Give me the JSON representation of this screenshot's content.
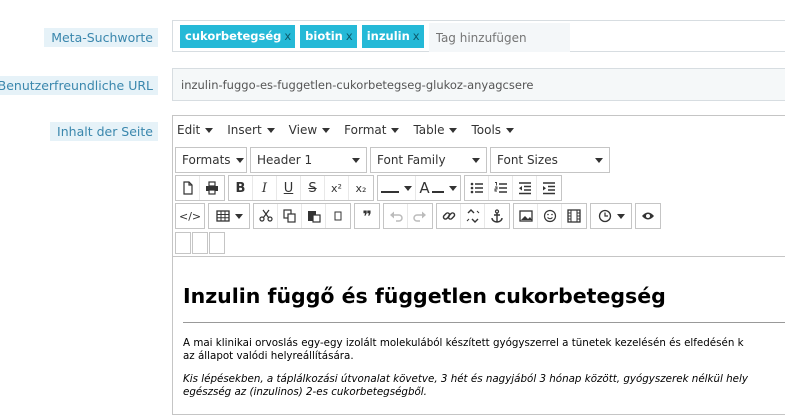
{
  "labels": {
    "meta": "Meta-Suchworte",
    "url": "Benutzerfreundliche URL",
    "content": "Inhalt der Seite"
  },
  "tags": [
    "cukorbetegség",
    "biotin",
    "inzulin"
  ],
  "tag_remove": "x",
  "tag_placeholder": "Tag hinzufügen",
  "url_value": "inzulin-fuggo-es-fuggetlen-cukorbetegseg-glukoz-anyagcsere",
  "editor": {
    "menu": [
      "Edit",
      "Insert",
      "View",
      "Format",
      "Table",
      "Tools"
    ],
    "selects": {
      "formats": "Formats",
      "block": "Header 1",
      "font_family": "Font Family",
      "font_sizes": "Font Sizes"
    },
    "text_buttons": {
      "bold": "B",
      "italic": "I",
      "underline": "U",
      "strike": "S",
      "superscript": "x²",
      "subscript": "x₂",
      "text_color": "A",
      "code": "</>",
      "blockquote": "❞"
    },
    "content": {
      "heading": "Inzulin függő és független cukorbetegség",
      "p1_line1": "A mai klinikai orvoslás egy-egy izolált molekulából készített gyógyszerrel a tünetek kezelésén és elfedésén k",
      "p1_line2": "az állapot valódi helyreállítására.",
      "p2_line1": "Kis lépésekben, a táplálkozási útvonalat követve, 3 hét és nagyjából 3 hónap között, gyógyszerek nélkül hely",
      "p2_line2": "egészség az (inzulinos) 2-es cukorbetegségből."
    }
  },
  "colors": {
    "tag": "#25b9d7",
    "label_bg": "#e6f2f8",
    "label_text": "#3a87ad"
  }
}
